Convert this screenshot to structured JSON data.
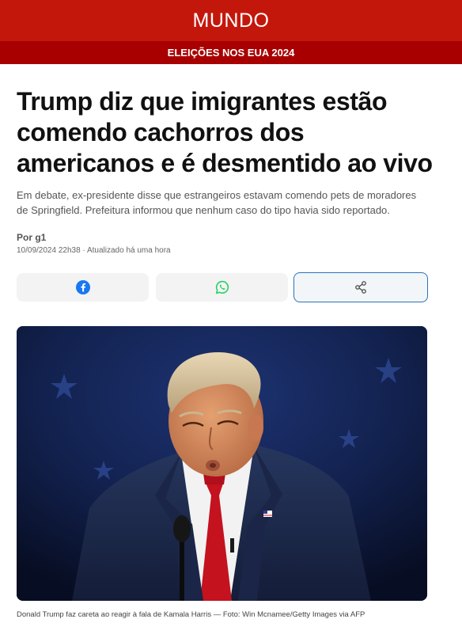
{
  "header": {
    "section": "MUNDO",
    "subsection": "ELEIÇÕES NOS EUA 2024"
  },
  "article": {
    "headline": "Trump diz que imigrantes estão comendo cachorros dos americanos e é desmentido ao vivo",
    "subheadline": "Em debate, ex-presidente disse que estrangeiros estavam comendo pets de moradores de Springfield. Prefeitura informou que nenhum caso do tipo havia sido reportado.",
    "byline": "Por g1",
    "dateline": "10/09/2024 22h38 · Atualizado há uma hora",
    "caption": "Donald Trump faz careta ao reagir à fala de Kamala Harris — Foto: Win Mcnamee/Getty Images via AFP"
  },
  "share": {
    "facebook_icon": "facebook-icon",
    "whatsapp_icon": "whatsapp-icon",
    "more_icon": "share-icon"
  },
  "colors": {
    "brand_red": "#c4170c",
    "sub_bar_red": "#a80000",
    "facebook_blue": "#1877f2",
    "whatsapp_green": "#25d366",
    "share_border_blue": "#2a72b8"
  }
}
